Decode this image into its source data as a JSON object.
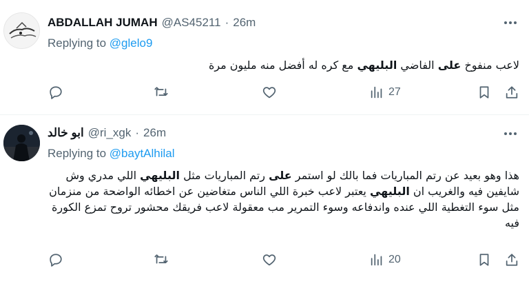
{
  "tweets": [
    {
      "name": "ABDALLAH JUMAH",
      "handle": "@AS45211",
      "separator": "·",
      "time": "26m",
      "replying_prefix": "Replying to",
      "replying_to": "@glelo9",
      "text_parts": [
        "لاعب منفوخ ",
        "على",
        " الفاضي ",
        "البليهي",
        " مع كره له أفضل منه مليون مرة"
      ],
      "views": "27",
      "avatar_icon": "drawing-avatar"
    },
    {
      "name": "ابو خالد",
      "handle": "@ri_xgk",
      "separator": "·",
      "time": "26m",
      "replying_prefix": "Replying to",
      "replying_to": "@baytAlhilal",
      "text_parts": [
        "هذا وهو بعيد عن رتم المباريات فما بالك لو استمر ",
        "على",
        " رتم المباريات مثل ",
        "البليهي",
        " اللي مدري وش شايفين فيه والغريب ان ",
        "البليهي",
        " يعتبر لاعب خبرة اللي الناس متغاضين عن اخطائه الواضحة من منزمان مثل سوء التغطية اللي عنده واندفاعه  وسوء التمرير مب معقولة لاعب فريقك محشور تروح تمزع الكورة فيه"
      ],
      "views": "20",
      "avatar_icon": "dark-photo-avatar"
    }
  ],
  "icons": {
    "reply": "speech-bubble-icon",
    "retweet": "retweet-icon",
    "like": "heart-icon",
    "views": "bar-chart-icon",
    "bookmark": "bookmark-icon",
    "share": "share-icon",
    "more": "more-dots-icon"
  },
  "colors": {
    "text": "#0f1419",
    "secondary": "#536471",
    "link": "#1d9bf0",
    "divider": "#eff3f4"
  }
}
